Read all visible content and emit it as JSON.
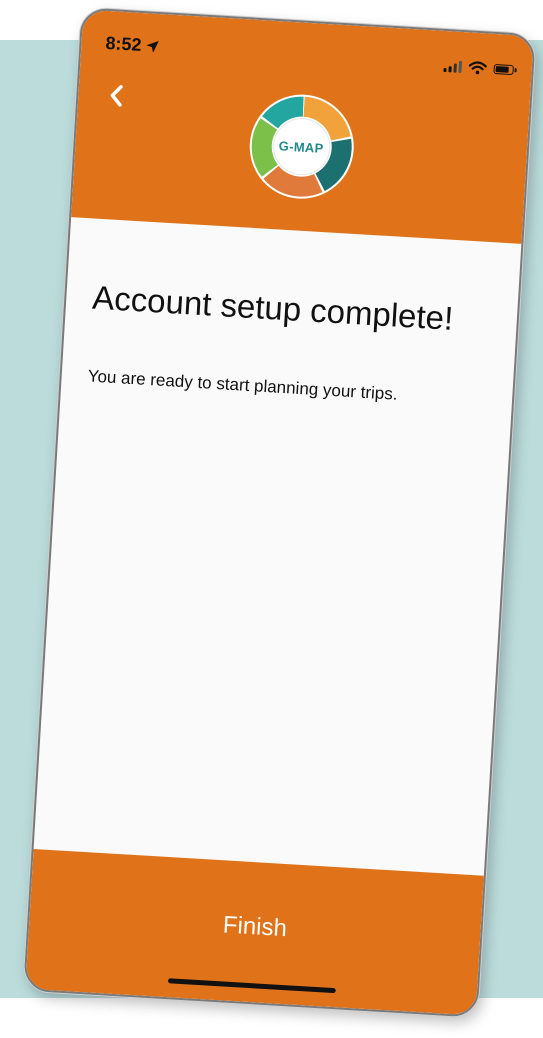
{
  "status_bar": {
    "time": "8:52"
  },
  "header": {
    "logo_text": "G-MAP",
    "accent_color": "#e0731a"
  },
  "main": {
    "title": "Account setup complete!",
    "subtitle": "You are ready to start planning your trips."
  },
  "footer": {
    "finish_label": "Finish"
  },
  "icons": {
    "back": "chevron-left-icon",
    "location": "location-arrow-icon",
    "signal": "cellular-signal-icon",
    "wifi": "wifi-icon",
    "battery": "battery-icon"
  }
}
